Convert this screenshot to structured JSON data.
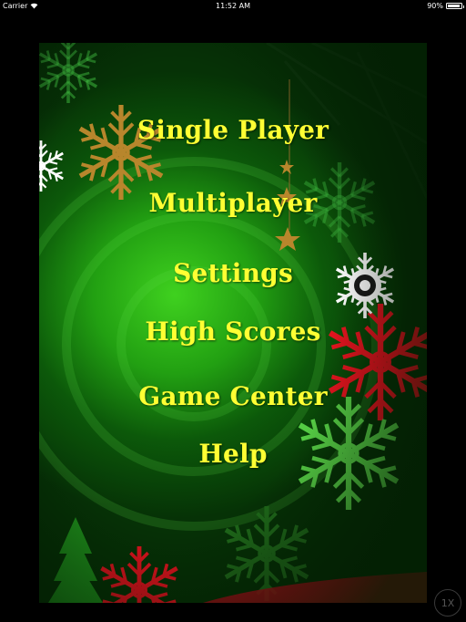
{
  "status_bar": {
    "carrier": "Carrier",
    "time": "11:52 AM",
    "battery": "90%",
    "battery_level": 0.9,
    "wifi_icon": "wifi-icon"
  },
  "menu": {
    "items": [
      {
        "label": "Single Player"
      },
      {
        "label": "Multiplayer"
      },
      {
        "label": "Settings"
      },
      {
        "label": "High Scores"
      },
      {
        "label": "Game Center"
      },
      {
        "label": "Help"
      }
    ]
  },
  "zoom_badge": "1X",
  "colors": {
    "menu_text": "#ffff33",
    "background_green": "#22a012",
    "snowflake_red": "#e0141e",
    "snowflake_gold": "#b8862c"
  }
}
